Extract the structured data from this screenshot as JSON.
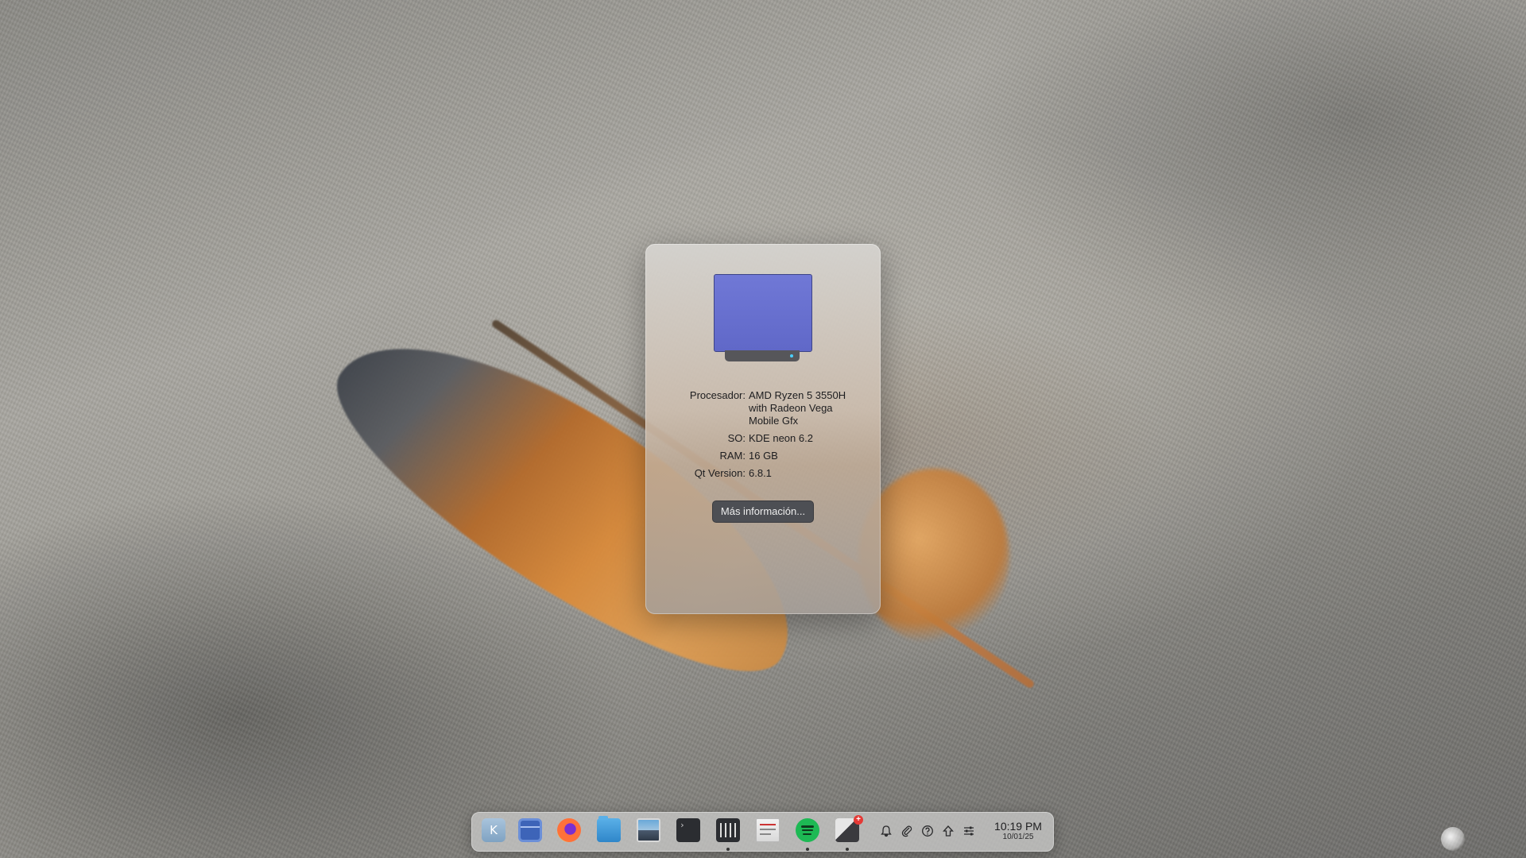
{
  "about": {
    "rows": [
      {
        "label": "Procesador:",
        "value": "AMD Ryzen 5 3550H with Radeon Vega Mobile Gfx"
      },
      {
        "label": "SO:",
        "value": "KDE neon 6.2"
      },
      {
        "label": "RAM:",
        "value": "16 GB"
      },
      {
        "label": "Qt Version:",
        "value": "6.8.1"
      }
    ],
    "more_info_label": "Más información...",
    "icon": "computer-icon"
  },
  "dock": {
    "apps": [
      {
        "name": "kde-launcher",
        "icon": "kde-logo-icon",
        "running": false
      },
      {
        "name": "window-switcher",
        "icon": "window-icon",
        "running": false
      },
      {
        "name": "firefox",
        "icon": "firefox-icon",
        "running": false
      },
      {
        "name": "file-manager",
        "icon": "folder-icon",
        "running": false
      },
      {
        "name": "image-viewer",
        "icon": "image-icon",
        "running": false
      },
      {
        "name": "terminal",
        "icon": "terminal-icon",
        "running": false
      },
      {
        "name": "mixer",
        "icon": "mixer-icon",
        "running": true
      },
      {
        "name": "document-viewer",
        "icon": "document-icon",
        "running": false
      },
      {
        "name": "spotify",
        "icon": "spotify-icon",
        "running": true
      },
      {
        "name": "updater",
        "icon": "updater-icon",
        "running": true,
        "badge": "+"
      }
    ],
    "tray": [
      {
        "icon": "notifications-icon",
        "glyph": "🔔"
      },
      {
        "icon": "attachment-icon",
        "glyph": "⌕"
      },
      {
        "icon": "help-icon",
        "glyph": "?"
      },
      {
        "icon": "upload-icon",
        "glyph": "⇧"
      },
      {
        "icon": "settings-icon",
        "glyph": "☰"
      }
    ],
    "clock": {
      "time": "10:19 PM",
      "date": "10/01/25"
    }
  }
}
